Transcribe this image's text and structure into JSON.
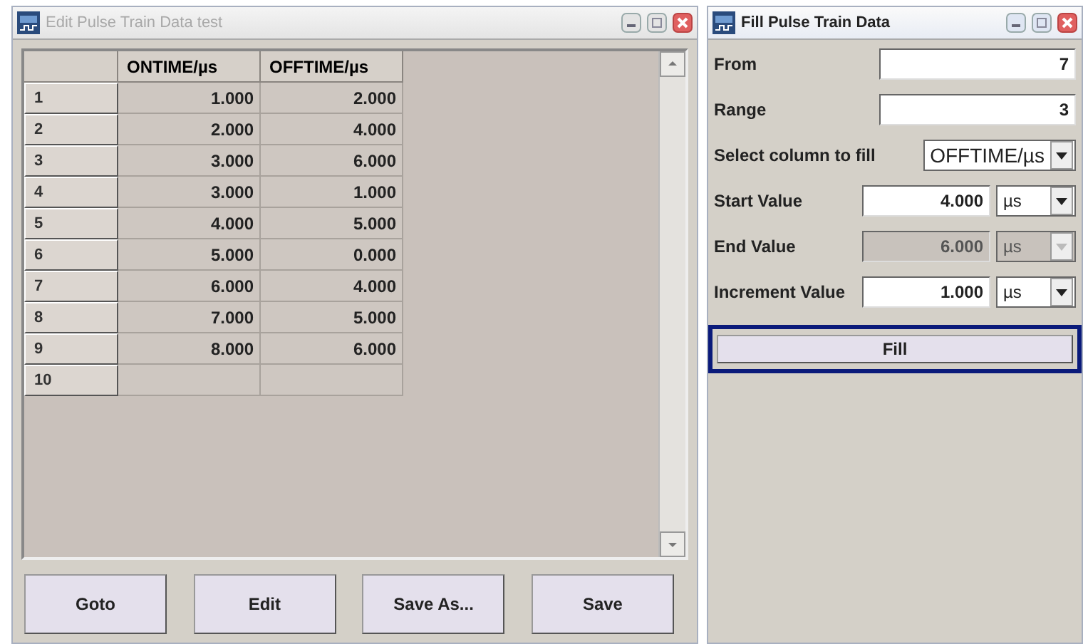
{
  "editor_window": {
    "title": "Edit Pulse Train Data test",
    "active": false,
    "table": {
      "columns": [
        "ONTIME/µs",
        "OFFTIME/µs"
      ],
      "rows": [
        {
          "index": "1",
          "cells": [
            "1.000",
            "2.000"
          ]
        },
        {
          "index": "2",
          "cells": [
            "2.000",
            "4.000"
          ]
        },
        {
          "index": "3",
          "cells": [
            "3.000",
            "6.000"
          ]
        },
        {
          "index": "4",
          "cells": [
            "3.000",
            "1.000"
          ]
        },
        {
          "index": "5",
          "cells": [
            "4.000",
            "5.000"
          ]
        },
        {
          "index": "6",
          "cells": [
            "5.000",
            "0.000"
          ]
        },
        {
          "index": "7",
          "cells": [
            "6.000",
            "4.000"
          ]
        },
        {
          "index": "8",
          "cells": [
            "7.000",
            "5.000"
          ]
        },
        {
          "index": "9",
          "cells": [
            "8.000",
            "6.000"
          ]
        },
        {
          "index": "10",
          "cells": [
            "",
            ""
          ]
        }
      ]
    },
    "buttons": [
      "Goto",
      "Edit",
      "Save As...",
      "Save"
    ]
  },
  "fill_window": {
    "title": "Fill Pulse Train Data",
    "active": true,
    "fields": [
      {
        "kind": "number",
        "label": "From",
        "value": "7",
        "disabled": false
      },
      {
        "kind": "number",
        "label": "Range",
        "value": "3",
        "disabled": false
      },
      {
        "kind": "select",
        "label": "Select column to fill",
        "value": "OFFTIME/µs",
        "disabled": false
      },
      {
        "kind": "unit",
        "label": "Start Value",
        "value": "4.000",
        "unit": "µs",
        "disabled": false
      },
      {
        "kind": "unit",
        "label": "End Value",
        "value": "6.000",
        "unit": "µs",
        "disabled": true
      },
      {
        "kind": "unit",
        "label": "Increment Value",
        "value": "1.000",
        "unit": "µs",
        "disabled": false
      }
    ],
    "fill_button": "Fill"
  }
}
